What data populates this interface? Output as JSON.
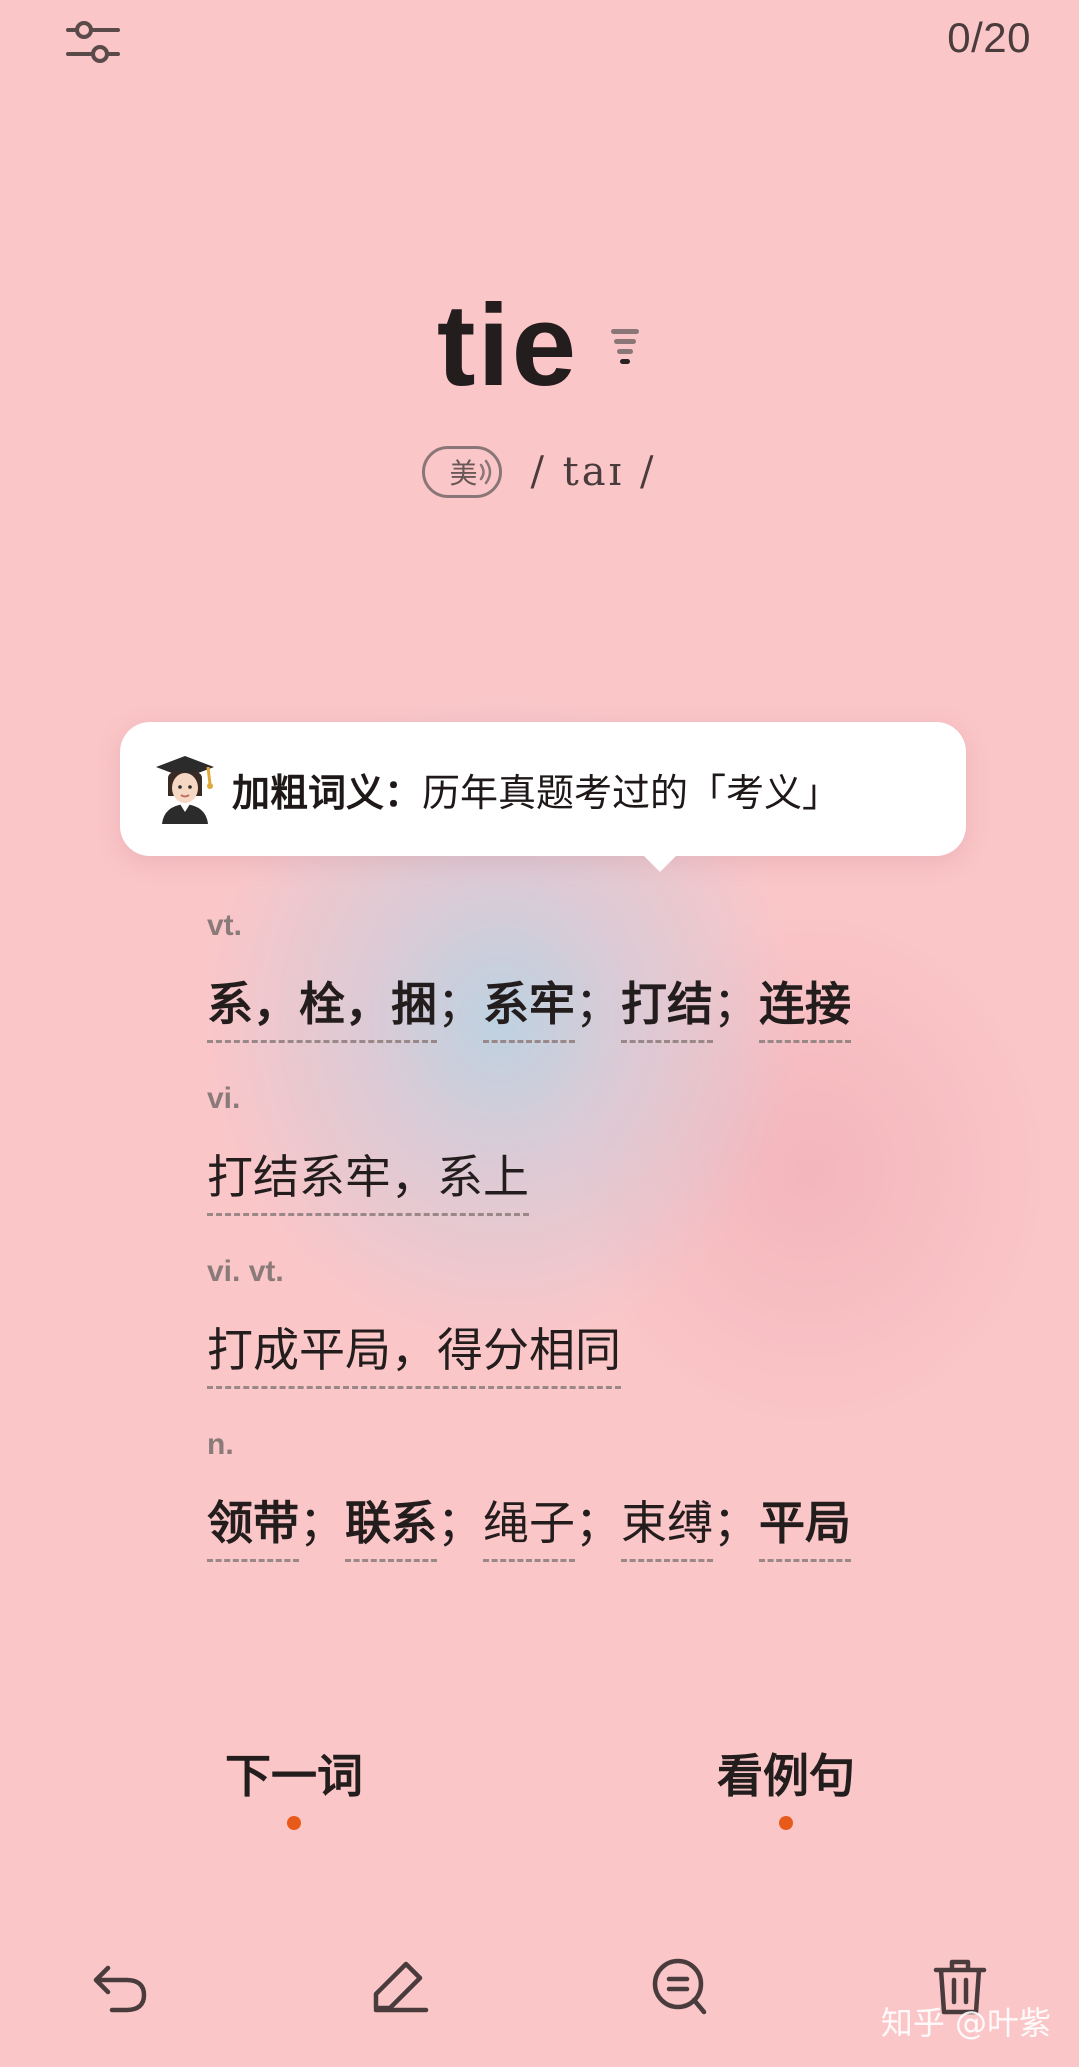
{
  "header": {
    "counter": "0/20",
    "settings_icon": "sliders-icon"
  },
  "word": {
    "text": "tie",
    "speaker_icon": "speaker-icon",
    "region_label": "美",
    "phonetic": "/ taɪ /"
  },
  "tooltip": {
    "bold": "加粗词义：",
    "text": "历年真题考过的「考义」",
    "avatar_icon": "student-avatar-icon"
  },
  "definitions": [
    {
      "pos": "vt.",
      "terms": [
        {
          "text": "系，栓，捆",
          "bold": true
        },
        {
          "text": "系牢",
          "bold": true
        },
        {
          "text": "打结",
          "bold": true
        },
        {
          "text": "连接",
          "bold": true
        }
      ]
    },
    {
      "pos": "vi.",
      "terms": [
        {
          "text": "打结系牢，系上",
          "bold": false
        }
      ]
    },
    {
      "pos": "vi.  vt.",
      "terms": [
        {
          "text": "打成平局，得分相同",
          "bold": false
        }
      ]
    },
    {
      "pos": "n.",
      "terms": [
        {
          "text": "领带",
          "bold": true
        },
        {
          "text": "联系",
          "bold": true
        },
        {
          "text": "绳子",
          "bold": false
        },
        {
          "text": "束缚",
          "bold": false
        },
        {
          "text": "平局",
          "bold": true
        }
      ]
    }
  ],
  "actions": {
    "next_word": "下一词",
    "view_examples": "看例句"
  },
  "toolbar": {
    "icons": [
      "undo-icon",
      "edit-icon",
      "comment-icon",
      "delete-icon"
    ]
  },
  "watermark": "知乎 @叶紫",
  "colors": {
    "background": "#fbc6c8",
    "accent_dot": "#e85a1a",
    "text": "#241d1d"
  }
}
